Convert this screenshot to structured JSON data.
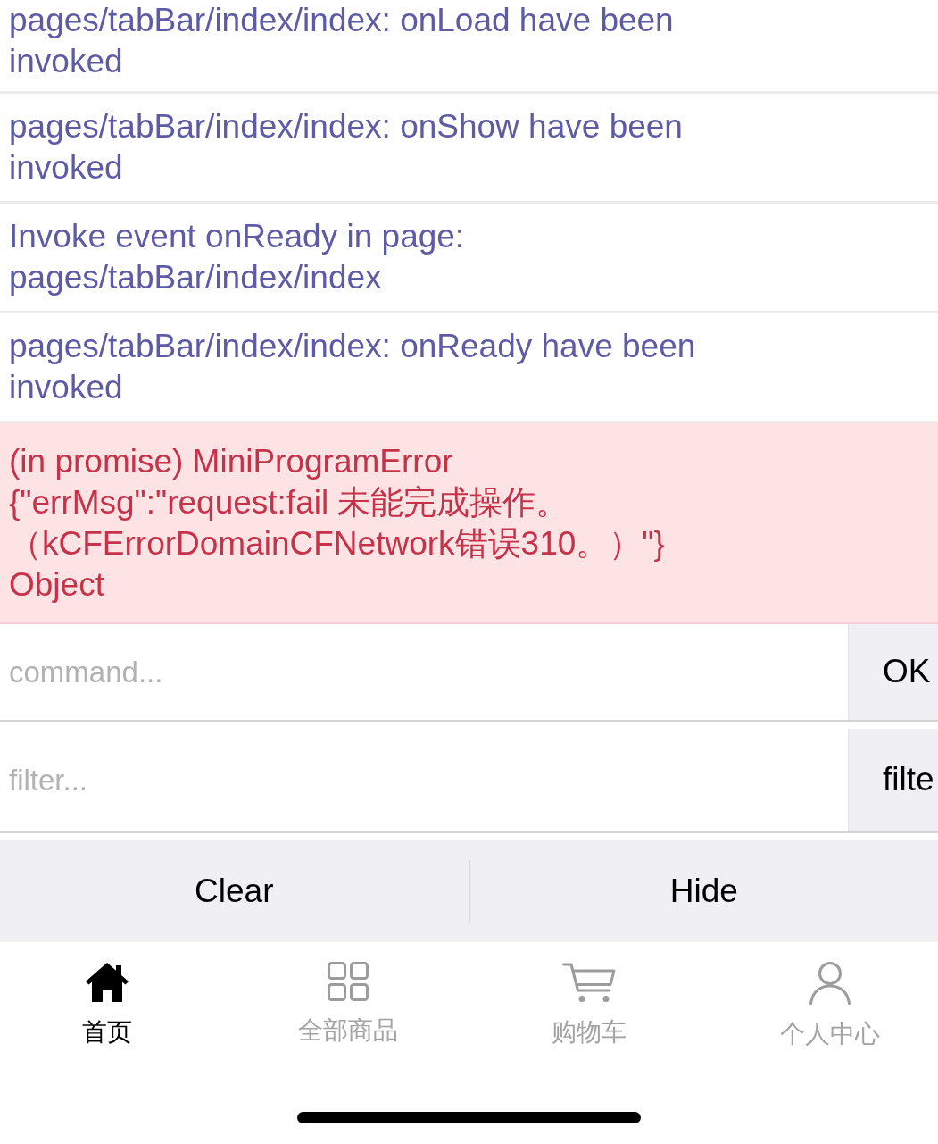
{
  "console": {
    "entries": [
      {
        "kind": "log",
        "text": "pages/tabBar/index/index: onLoad have been invoked"
      },
      {
        "kind": "log",
        "text": "pages/tabBar/index/index: onShow have been invoked"
      },
      {
        "kind": "log",
        "text": "Invoke event onReady in page: pages/tabBar/index/index"
      },
      {
        "kind": "log",
        "text": "pages/tabBar/index/index: onReady have been invoked"
      },
      {
        "kind": "error",
        "text": "(in promise) MiniProgramError {\"errMsg\":\"request:fail 未能完成操作。（kCFErrorDomainCFNetwork错误310。）\"} Object"
      }
    ]
  },
  "command": {
    "placeholder": "command...",
    "button": "OK"
  },
  "filter": {
    "placeholder": "filter...",
    "button": "filte"
  },
  "actions": [
    "Clear",
    "Hide"
  ],
  "tab_bar": [
    {
      "label": "首页",
      "selected": true
    },
    {
      "label": "全部商品",
      "selected": false
    },
    {
      "label": "购物车",
      "selected": false
    },
    {
      "label": "个人中心",
      "selected": false
    }
  ]
}
